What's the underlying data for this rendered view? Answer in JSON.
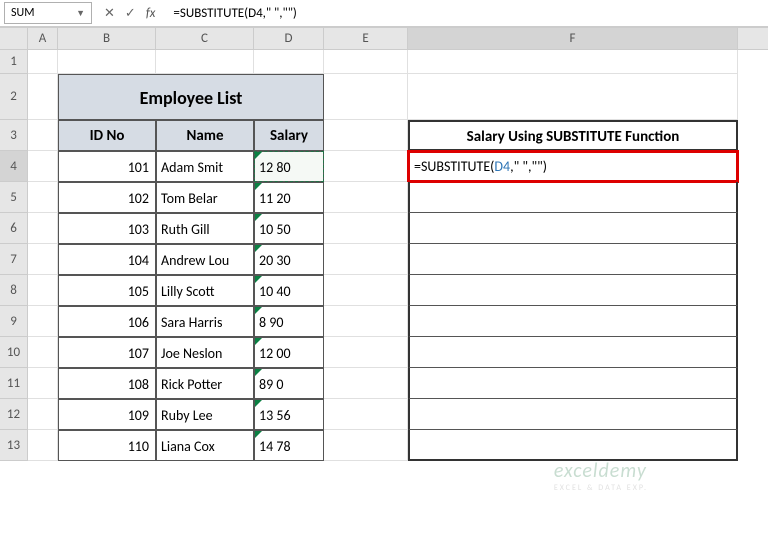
{
  "nameBox": "SUM",
  "formulaBar": "=SUBSTITUTE(D4,\" \",\"\")",
  "columns": [
    "A",
    "B",
    "C",
    "D",
    "E",
    "F"
  ],
  "title": "Employee List",
  "headers": {
    "id": "ID No",
    "name": "Name",
    "salary": "Salary"
  },
  "fHeader": "Salary Using SUBSTITUTE Function",
  "activeFormula": {
    "pre": "=SUBSTITUTE(",
    "ref": "D4",
    "post": ",\" \",\"\")"
  },
  "rows": [
    {
      "id": "101",
      "name": "Adam  Smit",
      "salary": "12 80"
    },
    {
      "id": "102",
      "name": "Tom   Belar",
      "salary": "11 20"
    },
    {
      "id": "103",
      "name": "  Ruth Gill",
      "salary": "10 50"
    },
    {
      "id": "104",
      "name": "Andrew   Lou",
      "salary": "20 30"
    },
    {
      "id": "105",
      "name": "  Lilly  Scott",
      "salary": "10 40"
    },
    {
      "id": "106",
      "name": "Sara   Harris",
      "salary": "8 90"
    },
    {
      "id": "107",
      "name": "Joe   Neslon",
      "salary": "12 00"
    },
    {
      "id": "108",
      "name": "  Rick  Potter",
      "salary": "89 0"
    },
    {
      "id": "109",
      "name": "Ruby  Lee",
      "salary": "13 56"
    },
    {
      "id": "110",
      "name": " Liana Cox",
      "salary": "14 78"
    }
  ],
  "watermark": {
    "main": "exceldemy",
    "sub": "EXCEL & DATA EXP."
  }
}
